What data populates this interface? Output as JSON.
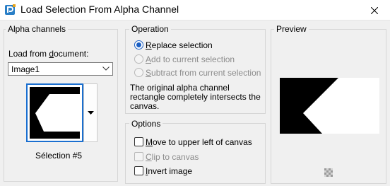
{
  "window": {
    "title": "Load Selection From Alpha Channel",
    "app_icon": "paintshop-pro-icon",
    "close_icon": "close-icon"
  },
  "alpha_channels": {
    "group_label": "Alpha channels",
    "load_from_document_label": "Load from document:",
    "document_value": "Image1",
    "selection_name": "Sélection #5"
  },
  "operation": {
    "group_label": "Operation",
    "options": [
      {
        "label": "Replace selection",
        "checked": true,
        "enabled": true
      },
      {
        "label": "Add to current selection",
        "checked": false,
        "enabled": false
      },
      {
        "label": "Subtract from current selection",
        "checked": false,
        "enabled": false
      }
    ],
    "message_lines": [
      "The original alpha channel",
      "rectangle completely intersects the",
      "canvas."
    ]
  },
  "options": {
    "group_label": "Options",
    "items": [
      {
        "label": "Move to upper left of canvas",
        "checked": false,
        "enabled": true
      },
      {
        "label": "Clip to canvas",
        "checked": false,
        "enabled": false
      },
      {
        "label": "Invert image",
        "checked": false,
        "enabled": true
      }
    ]
  },
  "preview": {
    "group_label": "Preview"
  },
  "colors": {
    "accent": "#1a5fc4",
    "thumbnail_border": "#1a6fd0",
    "disabled_text": "#8c8c8c"
  }
}
